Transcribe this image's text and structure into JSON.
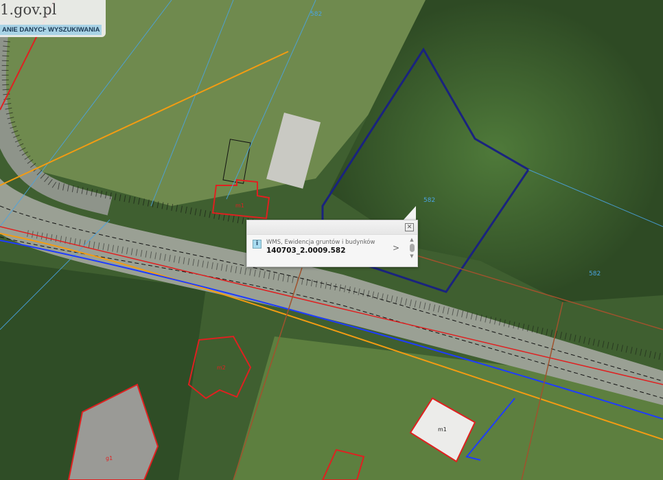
{
  "header": {
    "logo_text": "1.gov.pl",
    "tabs": [
      "ANIE DANYCH",
      "WYSZUKIWANIA"
    ]
  },
  "popup": {
    "source": "WMS, Ewidencja gruntów i budynków",
    "parcel_id": "140703_2.0009.582",
    "close_icon": "close-icon",
    "info_icon": "info-icon",
    "next_icon": "chevron-right-icon"
  },
  "map": {
    "parcel_labels": [
      "582",
      "582",
      "582"
    ],
    "building_labels": [
      "m1",
      "m2",
      "g1",
      "m1"
    ]
  },
  "colors": {
    "parcel": "#1a237e",
    "utility_orange": "#f39c12",
    "utility_blue": "#1e3cff",
    "building": "#e02020",
    "road_edge": "#222"
  }
}
